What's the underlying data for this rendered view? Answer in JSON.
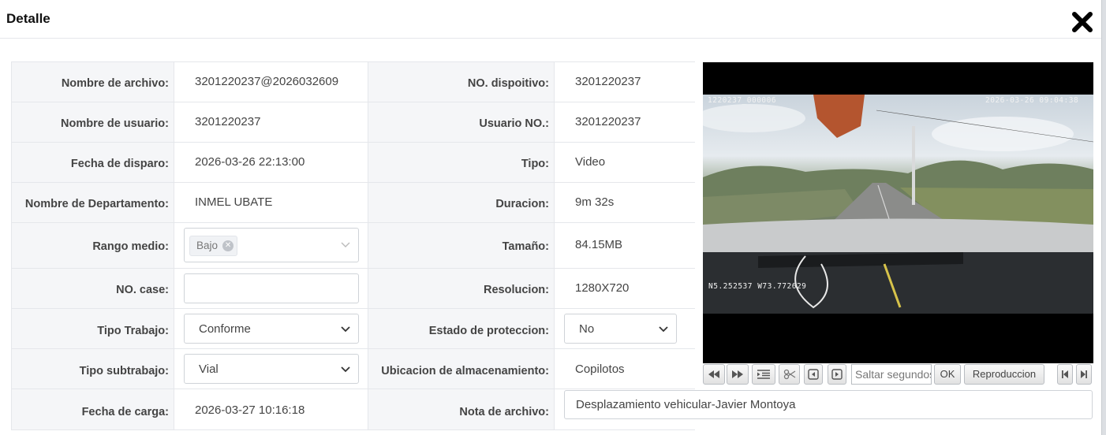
{
  "dialog": {
    "title": "Detalle",
    "close_icon": "close-icon"
  },
  "rows": [
    {
      "label1": "Nombre de archivo:",
      "value1": "3201220237@2026032609",
      "label2": "NO. dispoitivo:",
      "value2": "3201220237"
    },
    {
      "label1": "Nombre de usuario:",
      "value1": "3201220237",
      "label2": "Usuario NO.:",
      "value2": "3201220237"
    },
    {
      "label1": "Fecha de disparo:",
      "value1": "2026-03-26 22:13:00",
      "label2": "Tipo:",
      "value2": "Video"
    },
    {
      "label1": "Nombre de Departamento:",
      "value1": "INMEL UBATE",
      "label2": "Duracion:",
      "value2": "9m 32s"
    },
    {
      "label1": "Rango medio:",
      "tag": "Bajo",
      "label2": "Tamaño:",
      "value2": "84.15MB"
    },
    {
      "label1": "NO. case:",
      "case_value": "",
      "label2": "Resolucion:",
      "value2": "1280X720"
    },
    {
      "label1": "Tipo Trabajo:",
      "select1": "Conforme",
      "label2": "Estado de proteccion:",
      "select2": "No"
    },
    {
      "label1": "Tipo subtrabajo:",
      "select1": "Vial",
      "label2": "Ubicacion de almacenamiento:",
      "value2": "Copilotos"
    },
    {
      "label1": "Fecha de carga:",
      "value1": "2026-03-27 10:16:18",
      "label2": "Nota de archivo:",
      "note": "Desplazamiento vehicular-Javier Montoya"
    }
  ],
  "video": {
    "osd_top_left": "1220237_000006",
    "osd_top_right": "2026-03-26 09:04:38",
    "osd_gps": "N5.252537 W73.772629"
  },
  "player": {
    "rewind_icon": "rewind-icon",
    "forward_icon": "fast-forward-icon",
    "list_icon": "list-icon",
    "cut_icon": "scissors-icon",
    "prev_frame_icon": "prev-frame-icon",
    "next_frame_icon": "next-frame-icon",
    "jump_placeholder": "Saltar segundos",
    "ok_label": "OK",
    "play_label": "Reproduccion",
    "first_icon": "skip-first-icon",
    "last_icon": "skip-last-icon"
  }
}
